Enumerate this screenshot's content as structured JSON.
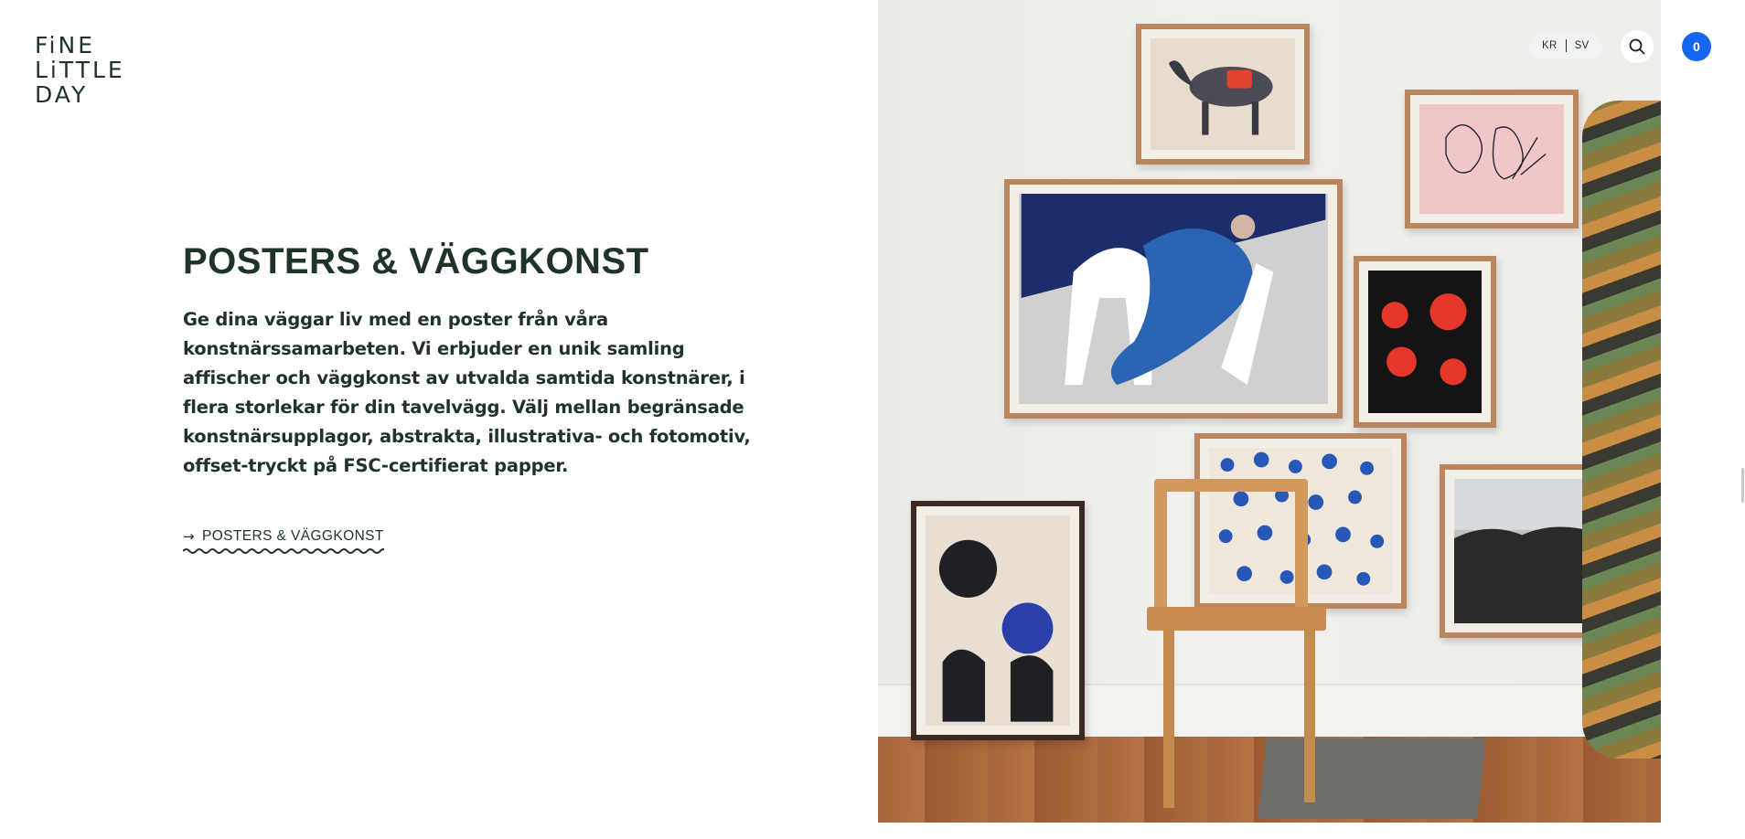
{
  "brand": {
    "logo_lines": [
      "FiNE",
      "LiTTLE",
      "DAY"
    ]
  },
  "header": {
    "currency": "KR",
    "language": "SV",
    "cart_count": "0",
    "accent_color": "#1666f0"
  },
  "hero": {
    "title": "POSTERS & VÄGGKONST",
    "description": "Ge dina väggar liv med en poster från våra konstnärssamarbeten. Vi erbjuder en unik samling affischer och väggkonst av utvalda samtida konstnärer, i flera storlekar för din tavelvägg. Välj mellan begränsade konstnärsupplagor, abstrakta, illustrativa- och fotomotiv, offset-tryckt på FSC-certifierat papper.",
    "cta_label": "POSTERS & VÄGGKONST",
    "text_color": "#1f3326"
  },
  "icons": {
    "cta_arrow": "arrow-right-icon",
    "search": "search-icon"
  }
}
